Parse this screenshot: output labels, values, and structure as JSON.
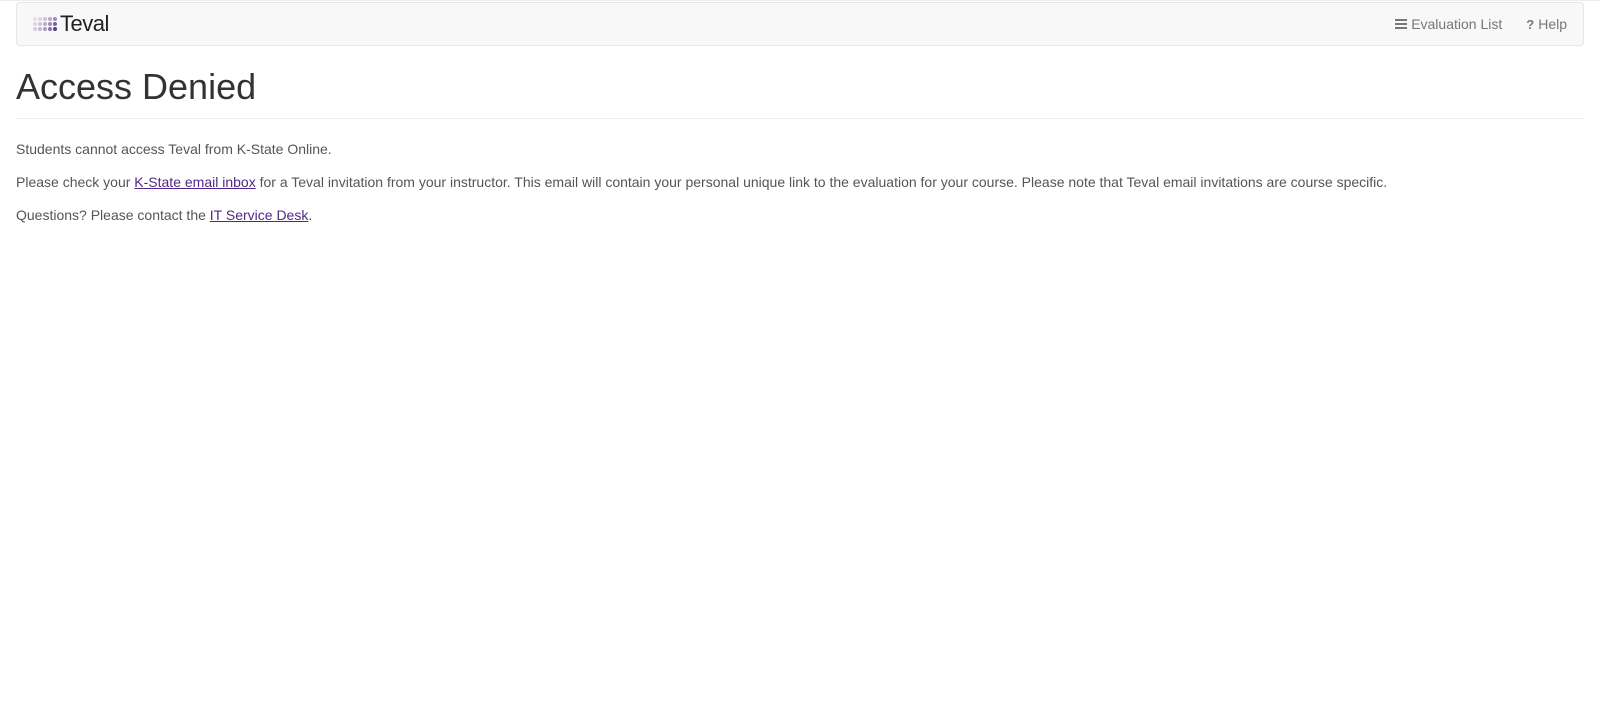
{
  "brand": {
    "name": "Teval"
  },
  "nav": {
    "evaluation_list": "Evaluation List",
    "help": "Help"
  },
  "page": {
    "title": "Access Denied",
    "p1": "Students cannot access Teval from K-State Online.",
    "p2_prefix": "Please check your ",
    "p2_link": "K-State email inbox",
    "p2_suffix": " for a Teval invitation from your instructor. This email will contain your personal unique link to the evaluation for your course. Please note that Teval email invitations are course specific.",
    "p3_prefix": "Questions? Please contact the ",
    "p3_link": "IT Service Desk",
    "p3_suffix": "."
  },
  "colors": {
    "link": "#512888"
  },
  "dot_opacities": [
    0.12,
    0.18,
    0.26,
    0.38,
    0.52,
    0.16,
    0.24,
    0.36,
    0.52,
    0.72,
    0.2,
    0.3,
    0.45,
    0.65,
    0.9
  ]
}
